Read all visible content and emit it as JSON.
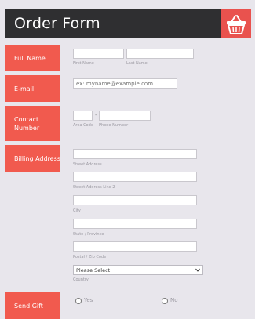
{
  "header": {
    "title": "Order Form",
    "icon": "basket-icon",
    "accent": "#e9524e"
  },
  "labels": {
    "full_name": "Full Name",
    "email": "E-mail",
    "contact_number": "Contact Number",
    "billing_address": "Billing Address",
    "send_gift": "Send Gift"
  },
  "name": {
    "first_sub": "First Name",
    "last_sub": "Last Name"
  },
  "email": {
    "placeholder": "ex: myname@example.com"
  },
  "phone": {
    "dash": "-",
    "area_sub": "Area Code",
    "number_sub": "Phone Number"
  },
  "address": {
    "street_sub": "Street Address",
    "street2_sub": "Street Address Line 2",
    "city_sub": "City",
    "state_sub": "State / Province",
    "zip_sub": "Postal / Zip Code",
    "country_selected": "Please Select",
    "country_sub": "Country"
  },
  "gift": {
    "yes": "Yes",
    "no": "No"
  },
  "colors": {
    "label_bg": "#f15a4e",
    "header_bg": "#2f2f31",
    "page_bg": "#e8e6ec"
  }
}
